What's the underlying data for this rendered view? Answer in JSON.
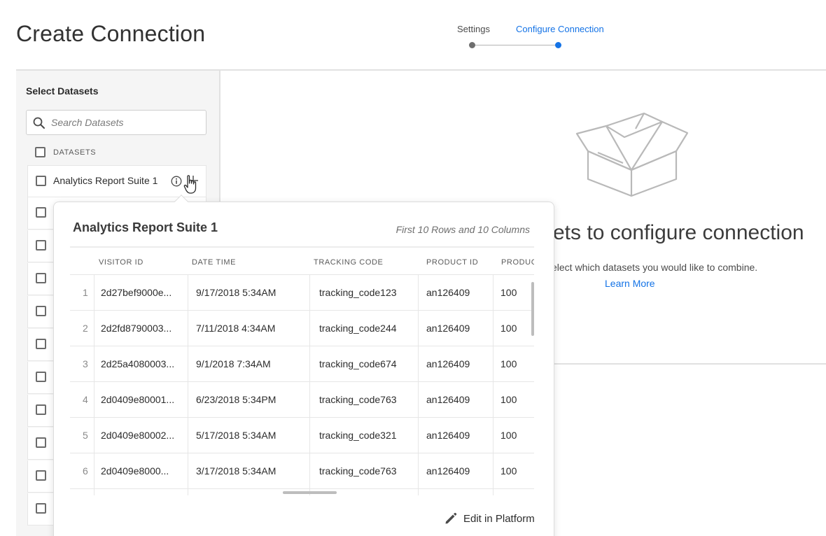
{
  "page": {
    "title": "Create Connection"
  },
  "stepper": {
    "steps": [
      "Settings",
      "Configure Connection"
    ],
    "active_index": 1
  },
  "left_panel": {
    "heading": "Select Datasets",
    "search_placeholder": "Search Datasets",
    "column_header": "DATASETS",
    "datasets": [
      {
        "label": "Analytics Report Suite 1"
      },
      {
        "label": ""
      },
      {
        "label": ""
      },
      {
        "label": ""
      },
      {
        "label": ""
      },
      {
        "label": ""
      },
      {
        "label": ""
      },
      {
        "label": ""
      },
      {
        "label": ""
      },
      {
        "label": ""
      },
      {
        "label": ""
      }
    ]
  },
  "empty_state": {
    "title": "sets to configure connection",
    "description": "elect which datasets you would like to combine.",
    "link": "Learn More"
  },
  "preview": {
    "title": "Analytics Report Suite 1",
    "subtitle": "First 10 Rows and 10 Columns",
    "columns": [
      "VISITOR ID",
      "DATE TIME",
      "TRACKING CODE",
      "PRODUCT ID",
      "PRODUC"
    ],
    "rows": [
      [
        "1",
        "2d27bef9000e...",
        "9/17/2018 5:34AM",
        "tracking_code123",
        "an126409",
        "100"
      ],
      [
        "2",
        "2d2fd8790003...",
        "7/11/2018 4:34AM",
        "tracking_code244",
        "an126409",
        "100"
      ],
      [
        "3",
        "2d25a4080003...",
        "9/1/2018 7:34AM",
        "tracking_code674",
        "an126409",
        "100"
      ],
      [
        "4",
        "2d0409e80001...",
        "6/23/2018 5:34PM",
        "tracking_code763",
        "an126409",
        "100"
      ],
      [
        "5",
        "2d0409e80002...",
        "5/17/2018 5:34AM",
        "tracking_code321",
        "an126409",
        "100"
      ],
      [
        "6",
        "2d0409e8000...",
        "3/17/2018 5:34AM",
        "tracking_code763",
        "an126409",
        "100"
      ]
    ],
    "edit_label": "Edit in Platform"
  },
  "icons": {
    "search": "search-icon",
    "info": "info-icon",
    "add": "plus-icon",
    "cursor": "hand-pointer-icon",
    "edit": "pencil-icon",
    "empty": "open-box-icon"
  },
  "colors": {
    "accent": "#1473e6",
    "panel_bg": "#f5f5f5",
    "border": "#e1e1e1"
  }
}
